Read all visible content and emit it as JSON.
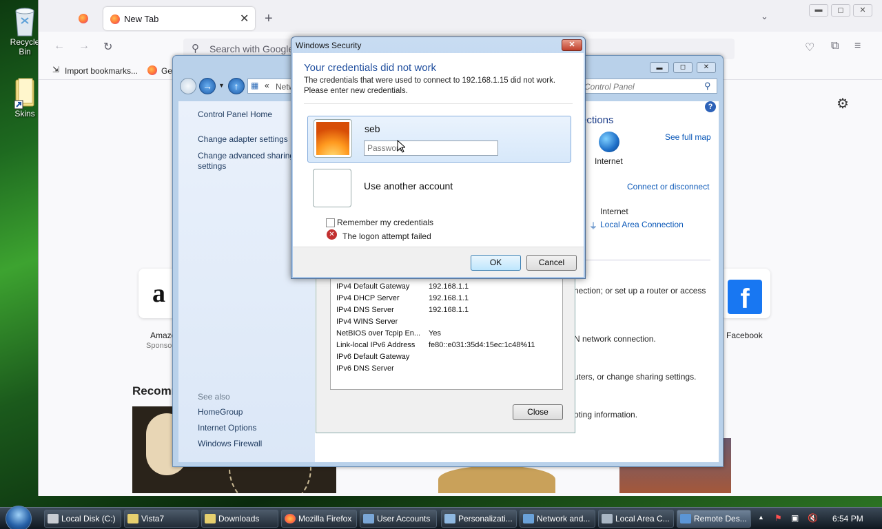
{
  "desktop": {
    "icons": [
      {
        "label": "Recycle Bin",
        "icon": "recycle-bin-icon"
      },
      {
        "label": "Skins",
        "icon": "folder-shortcut-icon"
      }
    ]
  },
  "firefox": {
    "tab_title": "New Tab",
    "search_placeholder": "Search with Google",
    "bookmarks": [
      {
        "label": "Import bookmarks..."
      },
      {
        "label": "Get"
      }
    ],
    "shortcuts": [
      {
        "label": "Amazo",
        "sub": "Sponso"
      },
      {
        "label": "Facebook",
        "sub": ""
      }
    ],
    "recommended_heading": "Recomm"
  },
  "control_panel": {
    "breadcrumb": "Netw",
    "search_placeholder": "Control Panel",
    "left_nav": [
      "Control Panel Home",
      "Change adapter settings",
      "Change advanced sharing settings"
    ],
    "see_also_heading": "See also",
    "see_also": [
      "HomeGroup",
      "Internet Options",
      "Windows Firewall"
    ],
    "heading_partial": "ections",
    "see_full_map": "See full map",
    "internet_label": "Internet",
    "connect_or_disconnect": "Connect or disconnect",
    "access_type_value": "Internet",
    "connection_link": "Local Area Connection",
    "text_lines": [
      "nection; or set up a router or access",
      "N network connection.",
      "uters, or change sharing settings.",
      "oting information."
    ]
  },
  "details_dialog": {
    "rows": [
      {
        "name": "IPv4 Default Gateway",
        "value": "192.168.1.1"
      },
      {
        "name": "IPv4 DHCP Server",
        "value": "192.168.1.1"
      },
      {
        "name": "IPv4 DNS Server",
        "value": "192.168.1.1"
      },
      {
        "name": "IPv4 WINS Server",
        "value": ""
      },
      {
        "name": "NetBIOS over Tcpip En...",
        "value": "Yes"
      },
      {
        "name": "Link-local IPv6 Address",
        "value": "fe80::e031:35d4:15ec:1c48%11"
      },
      {
        "name": "IPv6 Default Gateway",
        "value": ""
      },
      {
        "name": "IPv6 DNS Server",
        "value": ""
      }
    ],
    "close_label": "Close"
  },
  "security_dialog": {
    "title": "Windows Security",
    "heading": "Your credentials did not work",
    "message_line1": "The credentials that were used to connect to 192.168.1.15 did not work.",
    "message_line2": "Please enter new credentials.",
    "username": "seb",
    "password_placeholder": "Password",
    "other_account": "Use another account",
    "remember_label": "Remember my credentials",
    "remember_checked": false,
    "error_text": "The logon attempt failed",
    "ok_label": "OK",
    "cancel_label": "Cancel"
  },
  "taskbar": {
    "items": [
      {
        "label": "Local Disk (C:)",
        "icon": "drive-icon"
      },
      {
        "label": "Vista7",
        "icon": "folder-icon"
      },
      {
        "label": "Downloads",
        "icon": "folder-icon"
      },
      {
        "label": "Mozilla Firefox",
        "icon": "firefox-icon"
      },
      {
        "label": "User Accounts",
        "icon": "user-accounts-icon"
      },
      {
        "label": "Personalizati...",
        "icon": "personalization-icon"
      },
      {
        "label": "Network and...",
        "icon": "network-icon"
      },
      {
        "label": "Local Area C...",
        "icon": "network-adapter-icon"
      },
      {
        "label": "Remote Des...",
        "icon": "remote-desktop-icon"
      }
    ],
    "clock": "6:54 PM"
  },
  "colors": {
    "accent_blue": "#1f4e9e",
    "link_blue": "#0c59b8",
    "error_red": "#c23030"
  }
}
